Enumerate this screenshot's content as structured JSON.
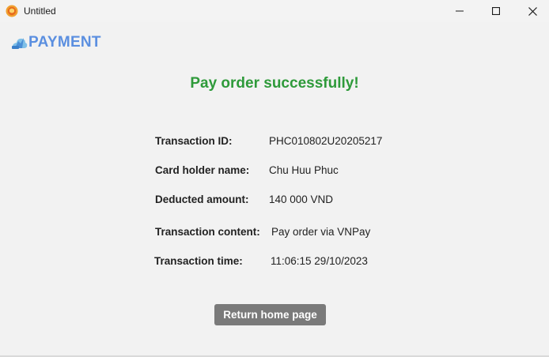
{
  "window": {
    "title": "Untitled",
    "icon": "orange-shield-app-icon",
    "controls": [
      "minimize-icon",
      "maximize-icon",
      "close-icon"
    ]
  },
  "brand": {
    "text": "PAYMENT",
    "icon": "payment-cloud-icon",
    "color": "#5b8fe0"
  },
  "status": {
    "message": "Pay order successfully!",
    "color": "#2e9a3a"
  },
  "details": [
    {
      "label": "Transaction ID:",
      "value": "PHC010802U20205217"
    },
    {
      "label": "Card holder name:",
      "value": "Chu Huu Phuc"
    },
    {
      "label": "Deducted amount:",
      "value": "140 000 VND"
    },
    {
      "label": "Transaction content:",
      "value": "Pay order via VNPay"
    },
    {
      "label": "Transaction time:",
      "value": "11:06:15 29/10/2023"
    }
  ],
  "actions": {
    "return_label": "Return home page",
    "button_color": "#7a7a7a"
  }
}
